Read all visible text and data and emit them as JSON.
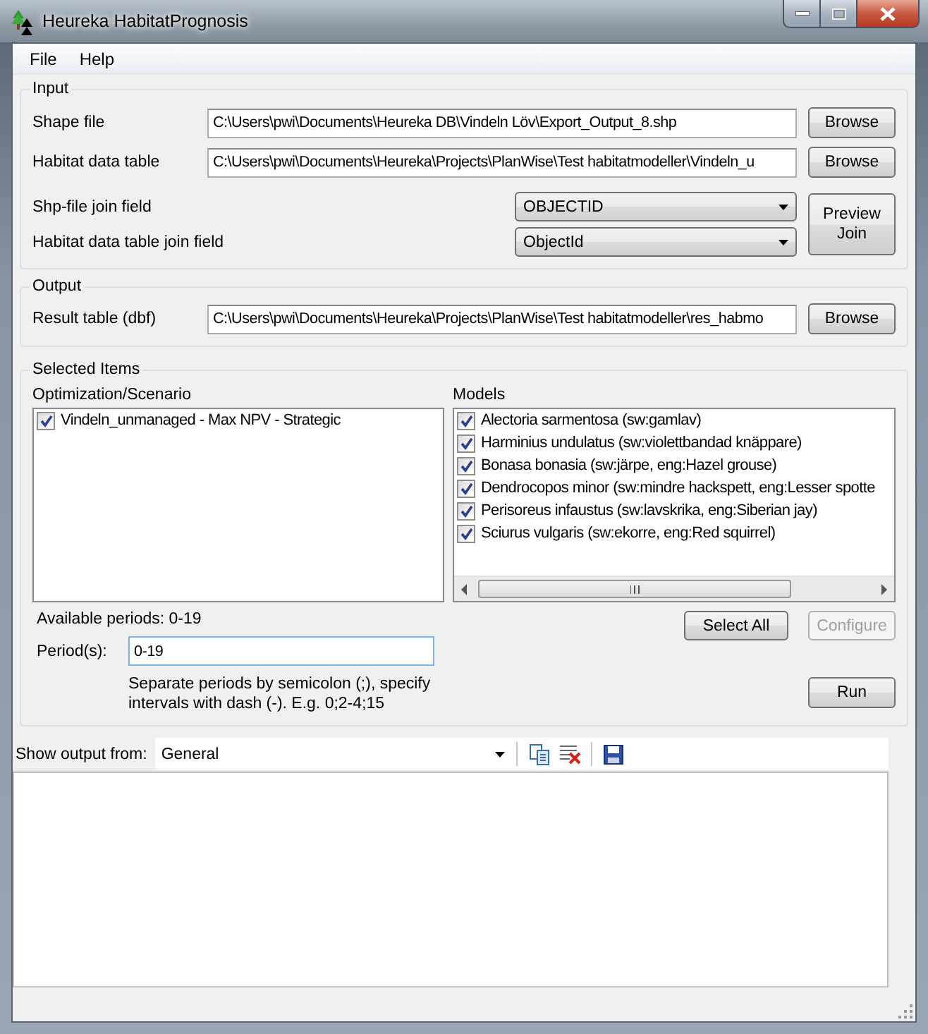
{
  "window": {
    "title": "Heureka HabitatPrognosis"
  },
  "menu": [
    {
      "label": "File"
    },
    {
      "label": "Help"
    }
  ],
  "input": {
    "title": "Input",
    "files": [
      {
        "label": "Shape file",
        "value": "C:\\Users\\pwi\\Documents\\Heureka DB\\Vindeln Löv\\Export_Output_8.shp",
        "button": "Browse"
      },
      {
        "label": "Habitat data table",
        "value": "C:\\Users\\pwi\\Documents\\Heureka\\Projects\\PlanWise\\Test habitatmodeller\\Vindeln_u",
        "button": "Browse"
      }
    ],
    "join_fields": [
      {
        "label": "Shp-file join field",
        "value": "OBJECTID"
      },
      {
        "label": "Habitat data table join field",
        "value": "ObjectId"
      }
    ],
    "preview_button": "Preview Join"
  },
  "output": {
    "title": "Output",
    "label": "Result table (dbf)",
    "value": "C:\\Users\\pwi\\Documents\\Heureka\\Projects\\PlanWise\\Test habitatmodeller\\res_habmo",
    "button": "Browse"
  },
  "selected_items": {
    "title": "Selected Items",
    "scenarios": {
      "title": "Optimization/Scenario",
      "items": [
        {
          "label": "Vindeln_unmanaged - Max NPV - Strategic",
          "checked": true
        }
      ]
    },
    "models": {
      "title": "Models",
      "items": [
        {
          "label": "Alectoria sarmentosa (sw:gamlav)",
          "checked": true
        },
        {
          "label": "Harminius undulatus (sw:violettbandad knäppare)",
          "checked": true
        },
        {
          "label": "Bonasa bonasia (sw:järpe, eng:Hazel grouse)",
          "checked": true
        },
        {
          "label": "Dendrocopos minor (sw:mindre hackspett, eng:Lesser spotte",
          "checked": true
        },
        {
          "label": "Perisoreus infaustus (sw:lavskrika, eng:Siberian jay)",
          "checked": true
        },
        {
          "label": "Sciurus vulgaris (sw:ekorre, eng:Red squirrel)",
          "checked": true
        }
      ]
    },
    "available_periods": "Available periods: 0-19",
    "periods": {
      "label": "Period(s):",
      "value": "0-19"
    },
    "hint": "Separate periods by semicolon (;), specify intervals with dash (-). E.g. 0;2-4;15",
    "buttons": [
      {
        "label": "Select All",
        "disabled": false
      },
      {
        "label": "Configure",
        "disabled": true
      }
    ],
    "run_button": {
      "label": "Run",
      "disabled": false
    }
  },
  "log": {
    "label": "Show output from:",
    "source": "General"
  }
}
